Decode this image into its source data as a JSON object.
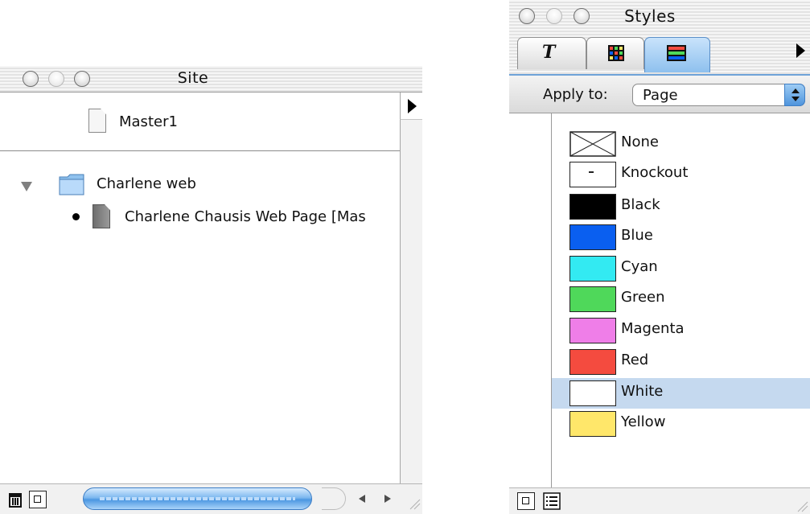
{
  "site_window": {
    "title": "Site",
    "master_page": "Master1",
    "folder": {
      "name": "Charlene web",
      "expanded": true
    },
    "page_item": "Charlene Chausis Web Page  [Mas"
  },
  "styles_window": {
    "title": "Styles",
    "tabs": [
      {
        "icon": "text-style-icon",
        "active": false
      },
      {
        "icon": "table-style-icon",
        "active": false
      },
      {
        "icon": "color-style-icon",
        "active": true
      }
    ],
    "apply_to_label": "Apply to:",
    "apply_to_value": "Page",
    "styles": [
      {
        "name": "None",
        "color": "none",
        "selected": false
      },
      {
        "name": "Knockout",
        "color": "knockout",
        "selected": false
      },
      {
        "name": "Black",
        "color": "#000000",
        "selected": false
      },
      {
        "name": "Blue",
        "color": "#0a5ff0",
        "selected": false
      },
      {
        "name": "Cyan",
        "color": "#33eaf2",
        "selected": false
      },
      {
        "name": "Green",
        "color": "#4fd85a",
        "selected": false
      },
      {
        "name": "Magenta",
        "color": "#ef7ee8",
        "selected": false
      },
      {
        "name": "Red",
        "color": "#f44b3f",
        "selected": false
      },
      {
        "name": "White",
        "color": "#ffffff",
        "selected": true
      },
      {
        "name": "Yellow",
        "color": "#ffe76a",
        "selected": false
      }
    ]
  },
  "colors": {
    "selection": "#c5d9ef",
    "accent": "#5b8fc8"
  }
}
